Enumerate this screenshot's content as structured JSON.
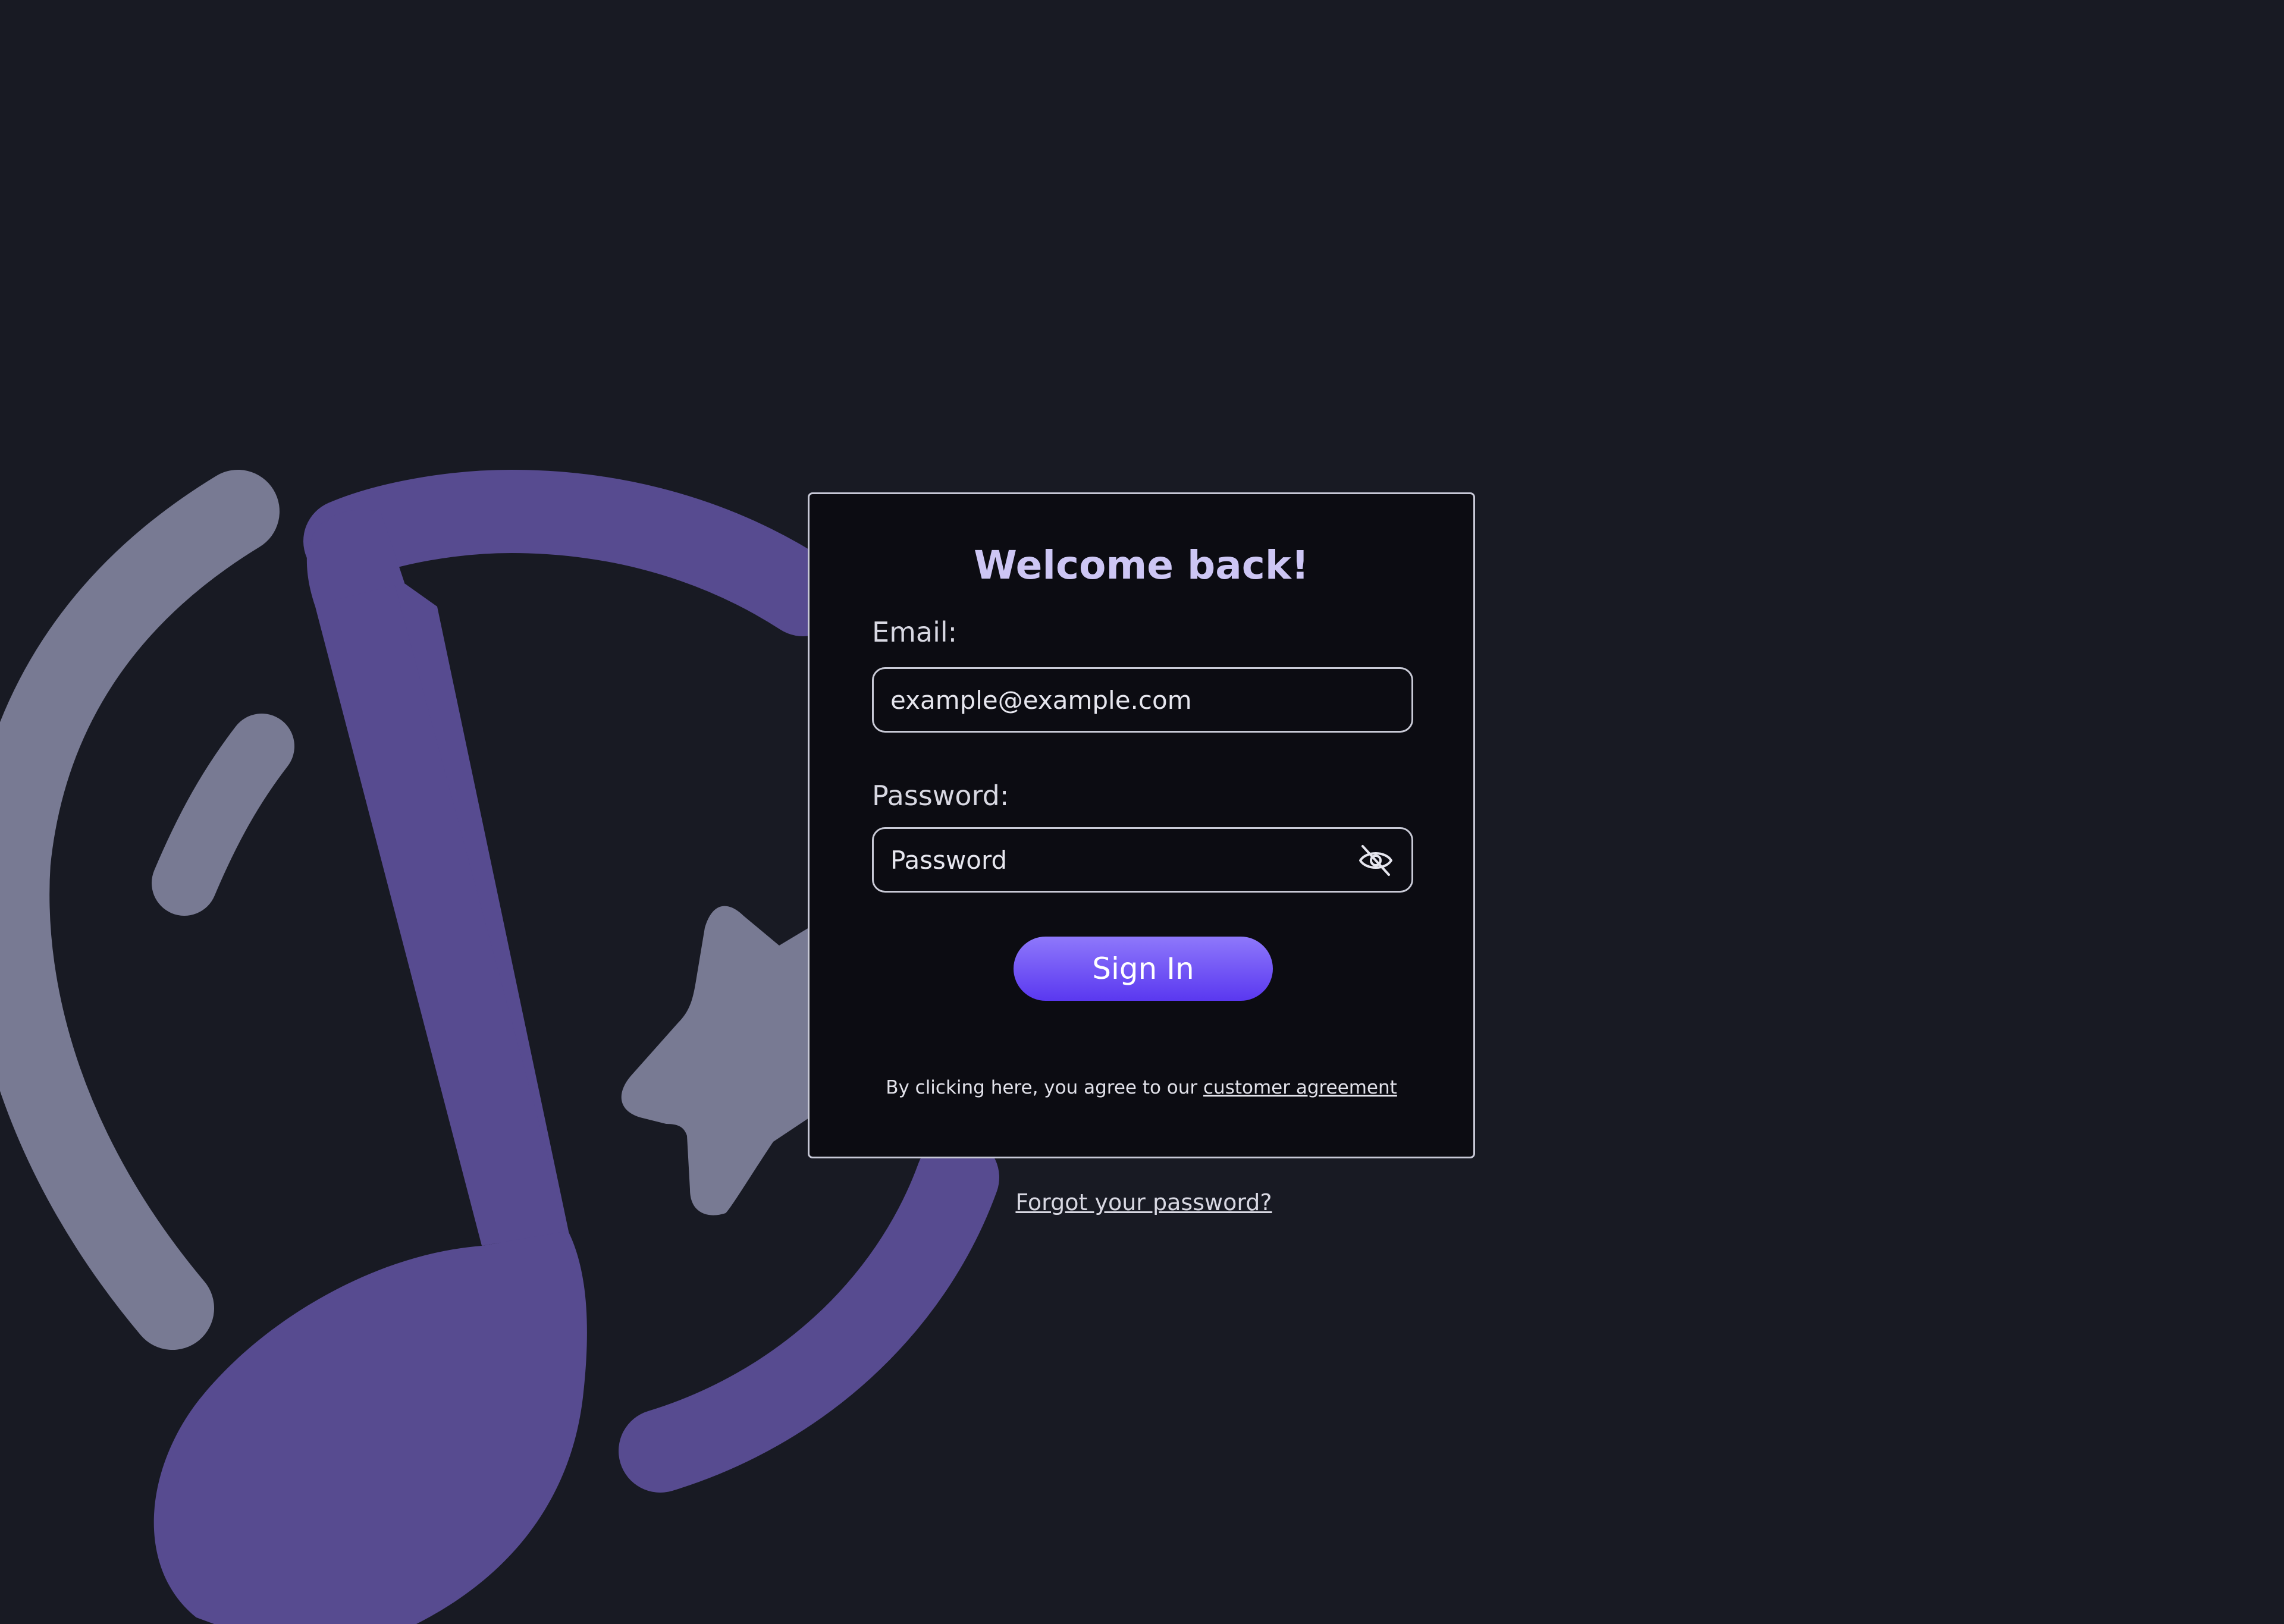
{
  "colors": {
    "background": "#181a23",
    "card_background": "#0c0c12",
    "accent": "#6b4ef5",
    "title": "#cdc6f4",
    "art_purple": "#574b90",
    "art_gray": "#787a93"
  },
  "login": {
    "title": "Welcome back!",
    "email_label": "Email:",
    "email_placeholder": "example@example.com",
    "password_label": "Password:",
    "password_placeholder": "Password",
    "toggle_icon": "eye-off-icon",
    "signin_label": "Sign In",
    "agreement_text": "By clicking here, you agree to our ",
    "agreement_link": "customer agreement"
  },
  "forgot_password": "Forgot your password?",
  "background_art": {
    "icon": "music-note-headphones-logo"
  }
}
